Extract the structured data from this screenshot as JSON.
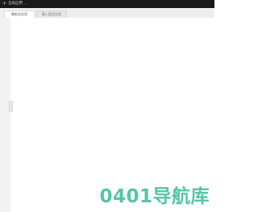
{
  "topbar": {
    "title": "全局应用",
    "plus_icon": "plus-icon",
    "chevron_icon": "chevron-down-icon"
  },
  "tabs": [
    {
      "label": "最新全应用",
      "active": true
    },
    {
      "label": "最入提全应用",
      "active": false
    }
  ],
  "collapse_handle": {
    "icon": "chevron-left-icon"
  },
  "watermark": {
    "text": "0401导航库",
    "color": "#56c4a8"
  }
}
